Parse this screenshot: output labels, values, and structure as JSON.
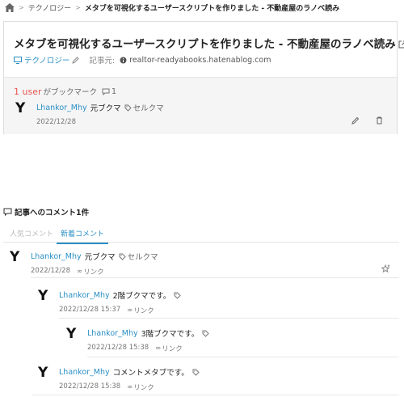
{
  "breadcrumb": {
    "category": "テクノロジー",
    "current": "メタブを可視化するユーザースクリプトを作りました - 不動産屋のラノベ読み"
  },
  "entry": {
    "title": "メタブを可視化するユーザースクリプトを作りました - 不動産屋のラノベ読み",
    "category": "テクノロジー",
    "source_label": "記事元:",
    "source_host": "realtor-readyabooks.hatenablog.com"
  },
  "bookmarks": {
    "count": "1 user",
    "suffix": "がブックマーク",
    "comment_count": "1",
    "item": {
      "user": "Lhankor_Mhy",
      "comment": "元ブクマ",
      "tag": "セルクマ",
      "date": "2022/12/28"
    }
  },
  "comments": {
    "heading": "記事へのコメント1件",
    "tab_popular": "人気コメント",
    "tab_new": "新着コメント",
    "link_label": "リンク",
    "items": [
      {
        "user": "Lhankor_Mhy",
        "text": "元ブクマ",
        "tag": "セルクマ",
        "date": "2022/12/28"
      },
      {
        "user": "Lhankor_Mhy",
        "text": "2階ブクマです。",
        "tag": "",
        "date": "2022/12/28 15:37"
      },
      {
        "user": "Lhankor_Mhy",
        "text": "3階ブクマです。",
        "tag": "",
        "date": "2022/12/28 15:38"
      },
      {
        "user": "Lhankor_Mhy",
        "text": "コメントメタブです。",
        "tag": "",
        "date": "2022/12/28 15:38"
      }
    ]
  },
  "colors": {
    "accent": "#2a8fc5",
    "count": "#e8554e",
    "panel": "#f5f5f6"
  }
}
